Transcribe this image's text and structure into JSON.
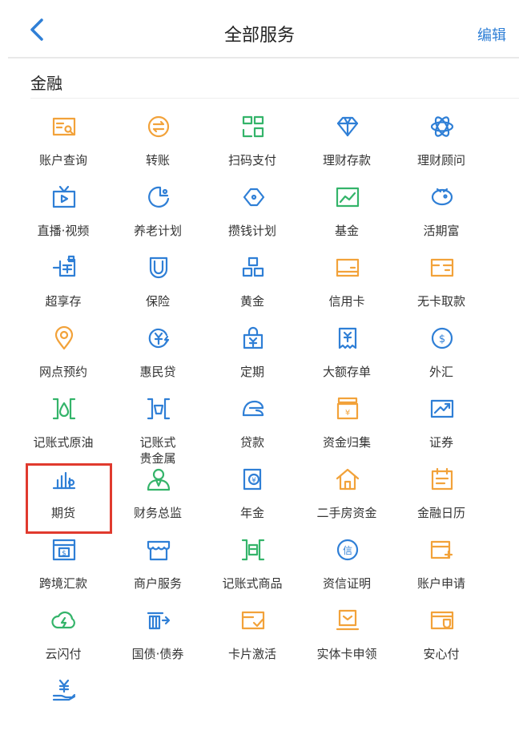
{
  "header": {
    "title": "全部服务",
    "edit_label": "编辑"
  },
  "section": {
    "title": "金融"
  },
  "colors": {
    "blue": "#2f7fd6",
    "orange": "#f2a23a",
    "green": "#34b46a",
    "highlight": "#e03a2e"
  },
  "items": [
    {
      "label": "账户查询",
      "icon": "account-query-icon"
    },
    {
      "label": "转账",
      "icon": "transfer-icon"
    },
    {
      "label": "扫码支付",
      "icon": "qr-pay-icon"
    },
    {
      "label": "理财存款",
      "icon": "diamond-icon"
    },
    {
      "label": "理财顾问",
      "icon": "atom-icon"
    },
    {
      "label": "直播·视频",
      "icon": "tv-icon"
    },
    {
      "label": "养老计划",
      "icon": "pension-icon"
    },
    {
      "label": "攒钱计划",
      "icon": "piggy-bank-icon"
    },
    {
      "label": "基金",
      "icon": "fund-chart-icon"
    },
    {
      "label": "活期富",
      "icon": "piggy-icon"
    },
    {
      "label": "超享存",
      "icon": "deposit-icon"
    },
    {
      "label": "保险",
      "icon": "shield-icon"
    },
    {
      "label": "黄金",
      "icon": "gold-bars-icon"
    },
    {
      "label": "信用卡",
      "icon": "credit-card-icon"
    },
    {
      "label": "无卡取款",
      "icon": "cardless-withdraw-icon"
    },
    {
      "label": "网点预约",
      "icon": "location-pin-icon"
    },
    {
      "label": "惠民贷",
      "icon": "loan-coin-icon"
    },
    {
      "label": "定期",
      "icon": "lock-bag-icon"
    },
    {
      "label": "大额存单",
      "icon": "receipt-icon"
    },
    {
      "label": "外汇",
      "icon": "dollar-coin-icon"
    },
    {
      "label": "记账式原油",
      "icon": "oil-drop-icon"
    },
    {
      "label": "记账式\n贵金属",
      "icon": "precious-metal-icon"
    },
    {
      "label": "贷款",
      "icon": "loan-hand-icon"
    },
    {
      "label": "资金归集",
      "icon": "fund-collect-icon"
    },
    {
      "label": "证券",
      "icon": "stock-chart-icon"
    },
    {
      "label": "期货",
      "icon": "futures-chart-icon"
    },
    {
      "label": "财务总监",
      "icon": "person-icon"
    },
    {
      "label": "年金",
      "icon": "annuity-icon"
    },
    {
      "label": "二手房资金",
      "icon": "house-icon"
    },
    {
      "label": "金融日历",
      "icon": "calendar-icon"
    },
    {
      "label": "跨境汇款",
      "icon": "cross-border-icon"
    },
    {
      "label": "商户服务",
      "icon": "store-icon"
    },
    {
      "label": "记账式商品",
      "icon": "commodity-icon"
    },
    {
      "label": "资信证明",
      "icon": "credit-cert-icon"
    },
    {
      "label": "账户申请",
      "icon": "account-apply-icon"
    },
    {
      "label": "云闪付",
      "icon": "cloud-pay-icon"
    },
    {
      "label": "国债·债券",
      "icon": "bond-icon"
    },
    {
      "label": "卡片激活",
      "icon": "card-activate-icon"
    },
    {
      "label": "实体卡申领",
      "icon": "card-apply-icon"
    },
    {
      "label": "安心付",
      "icon": "secure-pay-icon"
    },
    {
      "label": "",
      "icon": "yuan-hand-icon"
    }
  ]
}
